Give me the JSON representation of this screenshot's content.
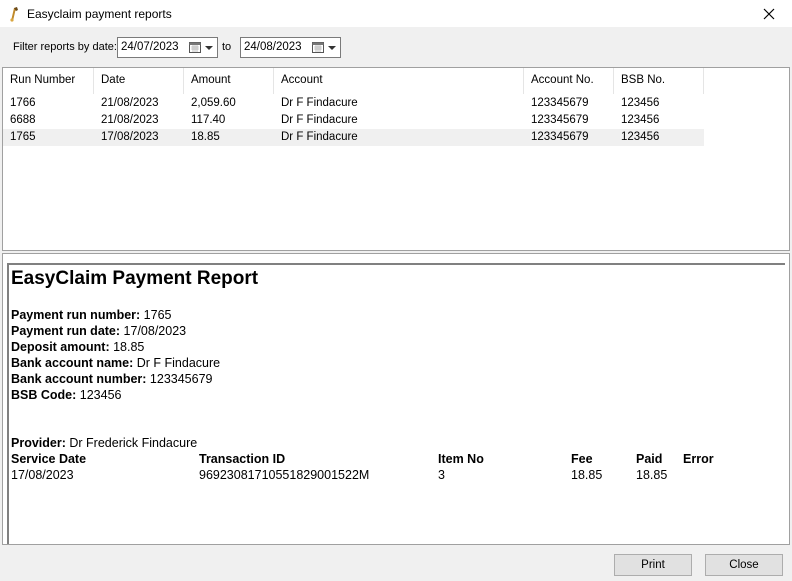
{
  "window": {
    "title": "Easyclaim payment reports"
  },
  "filter": {
    "label": "Filter reports by date:",
    "from_date": "24/07/2023",
    "to_label": "to",
    "to_date": "24/08/2023"
  },
  "table": {
    "columns": [
      "Run Number",
      "Date",
      "Amount",
      "Account",
      "Account No.",
      "BSB No."
    ],
    "rows": [
      [
        "1766",
        "21/08/2023",
        "2,059.60",
        "Dr F Findacure",
        "123345679",
        "123456"
      ],
      [
        "6688",
        "21/08/2023",
        "117.40",
        "Dr F Findacure",
        "123345679",
        "123456"
      ],
      [
        "1765",
        "17/08/2023",
        "18.85",
        "Dr F Findacure",
        "123345679",
        "123456"
      ]
    ],
    "selected_row": 2
  },
  "report": {
    "title": "EasyClaim Payment Report",
    "fields": [
      {
        "label": "Payment run number:",
        "value": "1765"
      },
      {
        "label": "Payment run date:",
        "value": "17/08/2023"
      },
      {
        "label": "Deposit amount:",
        "value": "18.85"
      },
      {
        "label": "Bank account name:",
        "value": "Dr F Findacure"
      },
      {
        "label": "Bank account number:",
        "value": "123345679"
      },
      {
        "label": "BSB Code:",
        "value": "123456"
      }
    ],
    "provider_label": "Provider:",
    "provider_value": "Dr Frederick Findacure",
    "detail_headers": [
      "Service Date",
      "Transaction ID",
      "Item No",
      "Fee",
      "Paid",
      "Error"
    ],
    "detail_rows": [
      [
        "17/08/2023",
        "96923081710551829001522M",
        "3",
        "18.85",
        "18.85",
        ""
      ]
    ]
  },
  "buttons": {
    "print": "Print",
    "close": "Close"
  }
}
